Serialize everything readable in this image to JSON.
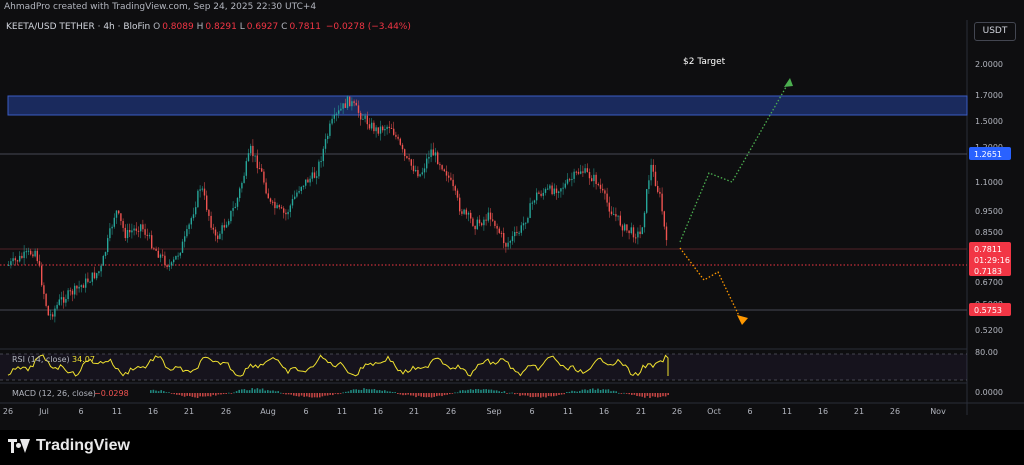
{
  "header": {
    "created_text": "AhmadPro created with TradingView.com, Sep 24, 2025 22:30 UTC+4",
    "symbol": "KEETA/USD TETHER · 4h · BloFin",
    "ohlc": {
      "o_label": "O",
      "o": "0.8089",
      "h_label": "H",
      "h": "0.8291",
      "l_label": "L",
      "l": "0.6927",
      "c_label": "C",
      "c": "0.7811",
      "change": "−0.0278 (−3.44%)"
    },
    "currency_button": "USDT"
  },
  "annotation": {
    "target_label": "$2 Target"
  },
  "price_axis": {
    "ticks": [
      "2.0000",
      "1.7000",
      "1.5000",
      "1.2000",
      "1.1000",
      "0.9500",
      "0.8500",
      "0.6700",
      "0.5000",
      "0.5200"
    ],
    "badges": {
      "level_blue": "1.2651",
      "last_price": "0.7811",
      "countdown": "01:29:16",
      "level_red_1": "0.7183",
      "level_red_2": "0.5753"
    }
  },
  "time_axis": {
    "ticks": [
      "26",
      "Jul",
      "6",
      "11",
      "16",
      "21",
      "26",
      "Aug",
      "6",
      "11",
      "16",
      "21",
      "26",
      "Sep",
      "6",
      "11",
      "16",
      "21",
      "26",
      "Oct",
      "6",
      "11",
      "16",
      "21",
      "26",
      "Nov"
    ]
  },
  "rsi": {
    "label": "RSI (14, close)",
    "value": "34.07",
    "axis_top": "80.00"
  },
  "macd": {
    "label": "MACD (12, 26, close)",
    "value": "−0.0298",
    "axis_zero": "0.0000"
  },
  "brand": {
    "name": "TradingView"
  },
  "colors": {
    "background": "#0e0e10",
    "bull": "#26a69a",
    "bear": "#ef5350",
    "zone": "#1c2f6b",
    "blue_badge": "#2962ff",
    "red_badge": "#f23645",
    "up_path": "#4caf50",
    "down_path": "#ff9800",
    "rsi_line": "#f0e130"
  },
  "drawings": {
    "resistance_zone_price_range": [
      1.54,
      1.69
    ],
    "horizontal_levels": [
      1.2651,
      0.7811,
      0.5753
    ],
    "dotted_level": 0.7183
  }
}
